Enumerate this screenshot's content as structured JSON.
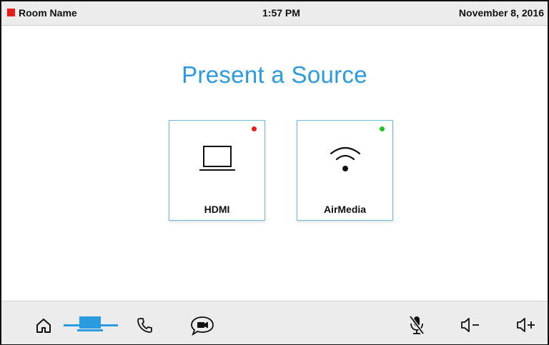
{
  "status_bar": {
    "room_name": "Room Name",
    "time": "1:57 PM",
    "date": "November 8, 2016",
    "indicator_color": "#e81c1c"
  },
  "main": {
    "title": "Present a Source",
    "sources": [
      {
        "label": "HDMI",
        "icon": "laptop-icon",
        "status": "red",
        "status_color": "#e81c1c"
      },
      {
        "label": "AirMedia",
        "icon": "wifi-icon",
        "status": "green",
        "status_color": "#1ec71e"
      }
    ]
  },
  "nav": {
    "left": [
      "home-icon",
      "present-icon",
      "phone-icon",
      "video-chat-icon"
    ],
    "right": [
      "mic-mute-icon",
      "volume-down-icon",
      "volume-up-icon"
    ],
    "active": "present-icon",
    "accent_color": "#2a9be0"
  }
}
